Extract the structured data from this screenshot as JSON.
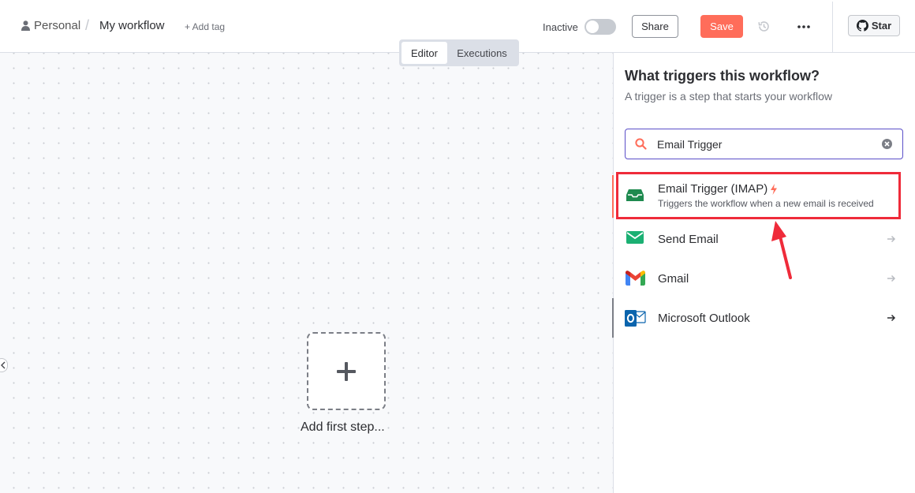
{
  "header": {
    "breadcrumb_owner": "Personal",
    "breadcrumb_separator": "/",
    "workflow_name": "My workflow",
    "add_tag_label": "+ Add tag",
    "status_label": "Inactive",
    "share_label": "Share",
    "save_label": "Save",
    "star_label": "Star"
  },
  "mode_switch": {
    "tabs": [
      {
        "label": "Editor",
        "active": true
      },
      {
        "label": "Executions",
        "active": false
      }
    ]
  },
  "canvas": {
    "add_first_step_label": "Add first step..."
  },
  "panel": {
    "title": "What triggers this workflow?",
    "subtitle": "A trigger is a step that starts your workflow",
    "search": {
      "value": "Email Trigger"
    },
    "results": [
      {
        "title": "Email Trigger (IMAP)",
        "description": "Triggers the workflow when a new email is received",
        "icon": "email-inbox-icon",
        "selected": true
      },
      {
        "title": "Send Email",
        "icon": "envelope-icon",
        "selected": false
      },
      {
        "title": "Gmail",
        "icon": "gmail-icon",
        "selected": false
      },
      {
        "title": "Microsoft Outlook",
        "icon": "outlook-icon",
        "selected": false
      }
    ]
  },
  "colors": {
    "accent": "#ff6d5a",
    "search_border": "#5b4fc8",
    "highlight_box": "#ef2b3a",
    "trigger_green": "#1e8a4f"
  }
}
